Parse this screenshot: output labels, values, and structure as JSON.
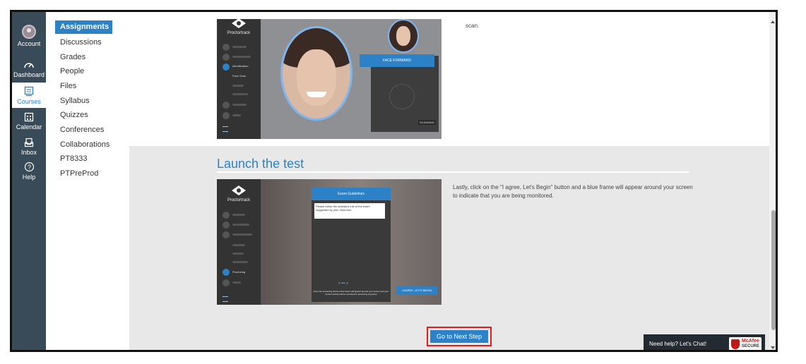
{
  "global_nav": {
    "items": [
      {
        "label": "Account",
        "icon": "avatar-icon"
      },
      {
        "label": "Dashboard",
        "icon": "dashboard-icon"
      },
      {
        "label": "Courses",
        "icon": "courses-icon"
      },
      {
        "label": "Calendar",
        "icon": "calendar-icon"
      },
      {
        "label": "Inbox",
        "icon": "inbox-icon"
      },
      {
        "label": "Help",
        "icon": "help-icon"
      }
    ]
  },
  "course_nav": {
    "items": [
      {
        "label": "Assignments"
      },
      {
        "label": "Discussions"
      },
      {
        "label": "Grades"
      },
      {
        "label": "People"
      },
      {
        "label": "Files"
      },
      {
        "label": "Syllabus"
      },
      {
        "label": "Quizzes"
      },
      {
        "label": "Conferences"
      },
      {
        "label": "Collaborations"
      },
      {
        "label": "PT8333"
      },
      {
        "label": "PTPreProd"
      }
    ]
  },
  "section1": {
    "text": "scan.",
    "screenshot": {
      "brand": "Proctortrack",
      "steps": [
        "Identification",
        "Face Scan"
      ],
      "banner": "FACE FORWARD",
      "status": "SCANNING"
    }
  },
  "section2": {
    "heading": "Launch the test",
    "description": "Lastly, click on the \"I agree, Let's Begin\" button and a blue frame will appear around your screen to indicate that you are being monitored.",
    "screenshot": {
      "brand": "Proctortrack",
      "step": "Proctoring",
      "dialog_title": "Exam Guidelines",
      "dialog_text": "Please follow the standard rule of the exam suggested by your instructor.",
      "dialog_footer": "Once the proctoring starts a blue frame will appear around your screen and your monitor activity will be recorded for proctoring purposes.",
      "agree_button": "I AGREE, LET'S BEGIN"
    }
  },
  "next_step_button": "Go to Next Step",
  "chat": {
    "label": "Need help? Let's Chat!"
  },
  "badge": {
    "line1": "McAfee",
    "line2": "SECURE"
  },
  "colors": {
    "canvas_nav": "#394b58",
    "accent": "#2d81c6",
    "highlight": "#e41b1b"
  }
}
